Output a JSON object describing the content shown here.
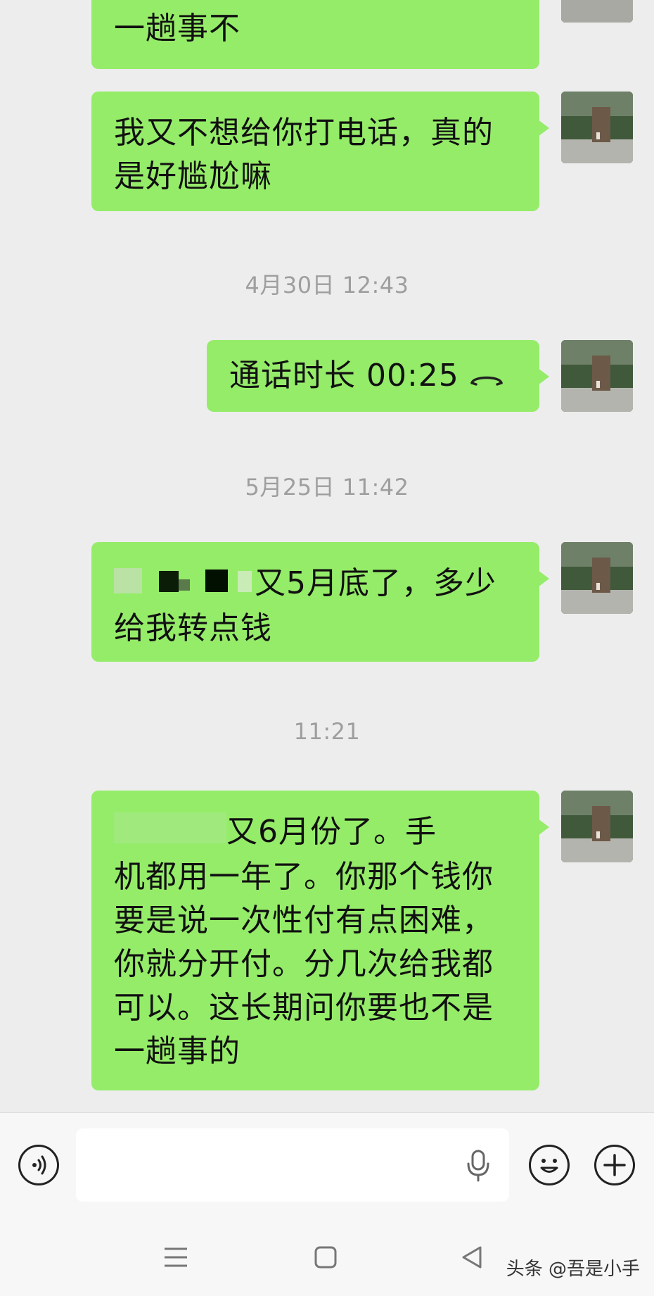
{
  "messages": [
    {
      "type": "text",
      "text": "一趟事不"
    },
    {
      "type": "text",
      "text": "我又不想给你打电话，真的是好尴尬嘛"
    },
    {
      "type": "time",
      "text": "4月30日 12:43"
    },
    {
      "type": "call",
      "text": "通话时长 00:25"
    },
    {
      "type": "time",
      "text": "5月25日 11:42"
    },
    {
      "type": "text",
      "line1": "又5月底了，多少",
      "line2": "给我转点钱"
    },
    {
      "type": "time",
      "text": "11:21"
    },
    {
      "type": "text",
      "line1": "又6月份了。手",
      "rest": "机都用一年了。你那个钱你要是说一次性付有点困难，你就分开付。分几次给我都可以。这长期问你要也不是一趟事的"
    }
  ],
  "icons": {
    "voice": "voice-mode-icon",
    "mic": "microphone-icon",
    "emoji": "emoji-icon",
    "plus": "plus-icon",
    "phone": "phone-hangup-icon",
    "menu": "menu-icon",
    "home": "home-icon",
    "back": "back-icon"
  },
  "watermark": "头条 @吾是小手",
  "colors": {
    "bubble": "#95ec69",
    "background": "#ededed",
    "time_text": "#9e9e9e"
  }
}
